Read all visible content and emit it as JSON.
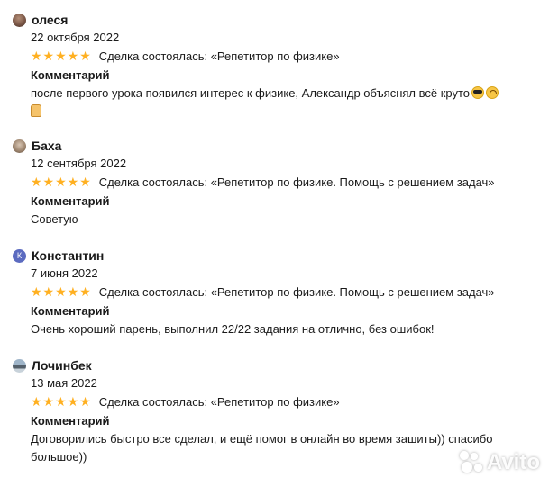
{
  "reviews": [
    {
      "name": "олеся",
      "date": "22 октября 2022",
      "rating": 5,
      "deal": "Сделка состоялась: «Репетитор по физике»",
      "comment_label": "Комментарий",
      "comment": "после первого урока появился интерес к физике, Александр объяснял всё круто"
    },
    {
      "name": "Баха",
      "date": "12 сентября 2022",
      "rating": 5,
      "deal": "Сделка состоялась: «Репетитор по физике. Помощь с решением задач»",
      "comment_label": "Комментарий",
      "comment": "Советую"
    },
    {
      "name": "Константин",
      "avatar_letter": "К",
      "date": "7 июня 2022",
      "rating": 5,
      "deal": "Сделка состоялась: «Репетитор по физике. Помощь с решением задач»",
      "comment_label": "Комментарий",
      "comment": "Очень хороший парень, выполнил 22/22 задания на отлично, без ошибок!"
    },
    {
      "name": "Лочинбек",
      "date": "13 мая 2022",
      "rating": 5,
      "deal": "Сделка состоялась: «Репетитор по физике»",
      "comment_label": "Комментарий",
      "comment": "Договорились быстро все сделал, и ещё помог в онлайн во время зашиты)) спасибо\nбольшое))"
    }
  ],
  "stars_glyph": "★★★★★",
  "star_color": "#ffb021",
  "watermark": "Avito"
}
